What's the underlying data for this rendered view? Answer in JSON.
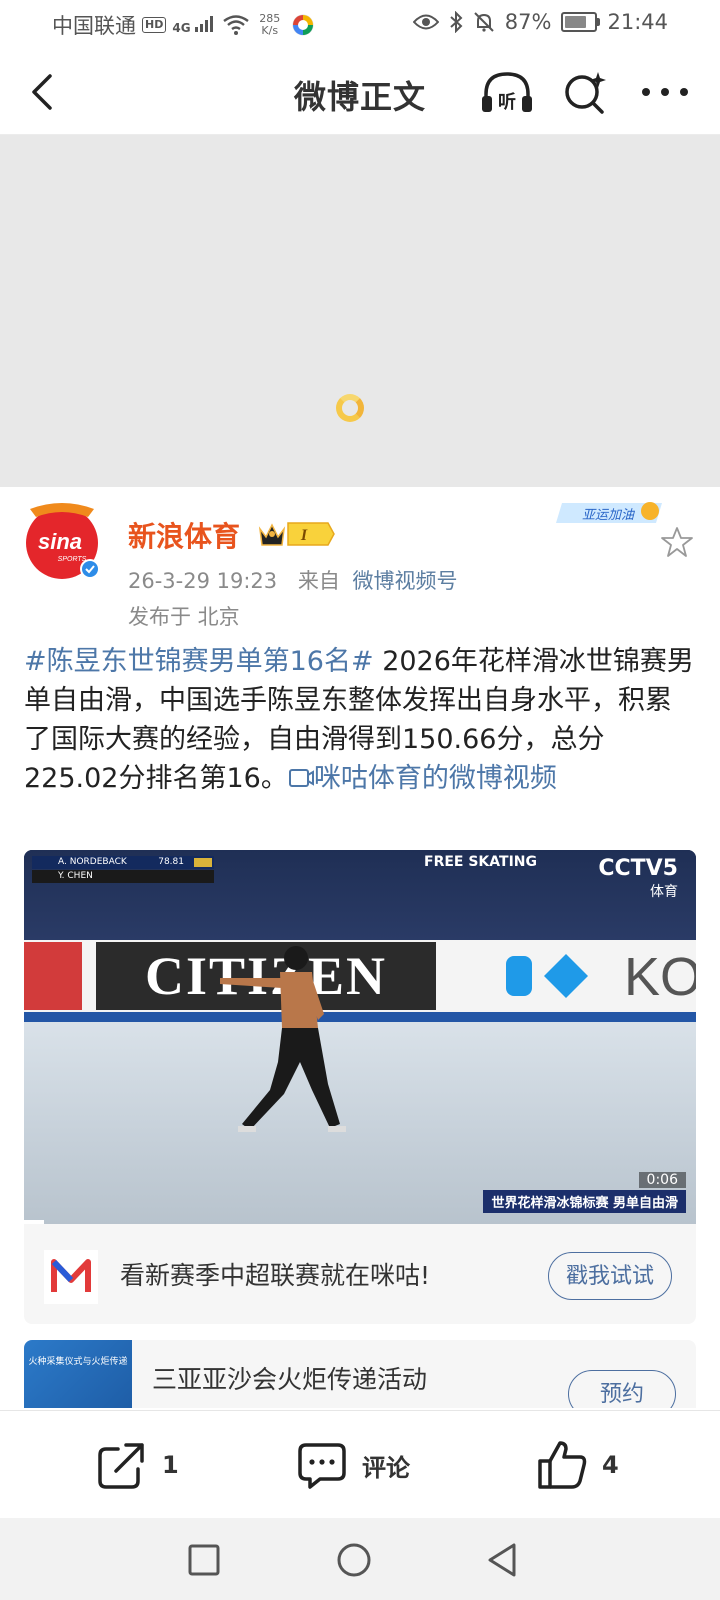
{
  "status_bar": {
    "carrier": "中国联通",
    "hd": "HD",
    "signal_gen": "4G",
    "net_speed": "285",
    "net_unit": "K/s",
    "battery": "87%",
    "battery_level": 0.87,
    "time": "21:44"
  },
  "nav": {
    "title": "微博正文",
    "listen_icon": "listen-headphones-icon",
    "search_icon": "search-sparkle-icon",
    "more_icon": "more-dots-icon"
  },
  "post": {
    "username": "新浪体育",
    "vip_level": "I",
    "date": "26-3-29 19:23",
    "from_label": "来自",
    "source": "微博视频号",
    "location": "发布于 北京",
    "badge_text": "亚运加油",
    "hashtag": "#陈昱东世锦赛男单第16名#",
    "body": " 2026年花样滑冰世锦赛男单自由滑，中国选手陈昱东整体发挥出自身水平，积累了国际大赛的经验，自由滑得到150.66分，总分225.02分排名第16。",
    "video_link": "咪咕体育的微博视频"
  },
  "video": {
    "score_line1_name": "A. NORDEBACK",
    "score_line1_value": "78.81",
    "score_line2_name": "Y. CHEN",
    "segment_label": "FREE SKATING",
    "channel": "CCTV5",
    "channel_sub": "体育",
    "board_text": "CITIZEN",
    "board_text2": "KO",
    "duration": "0:06",
    "caption": "世界花样滑冰锦标赛 男单自由滑"
  },
  "promo": {
    "text": "看新赛季中超联赛就在咪咕!",
    "button": "戳我试试"
  },
  "event_card": {
    "title": "三亚亚沙会火炬传递活动",
    "button": "预约",
    "image_text": "火种采集仪式与火炬传递"
  },
  "actions": {
    "share_count": "1",
    "comment_label": "评论",
    "like_count": "4"
  },
  "colors": {
    "link": "#4d77a8",
    "username": "#e8541e",
    "spinner": "#f6c94a"
  }
}
